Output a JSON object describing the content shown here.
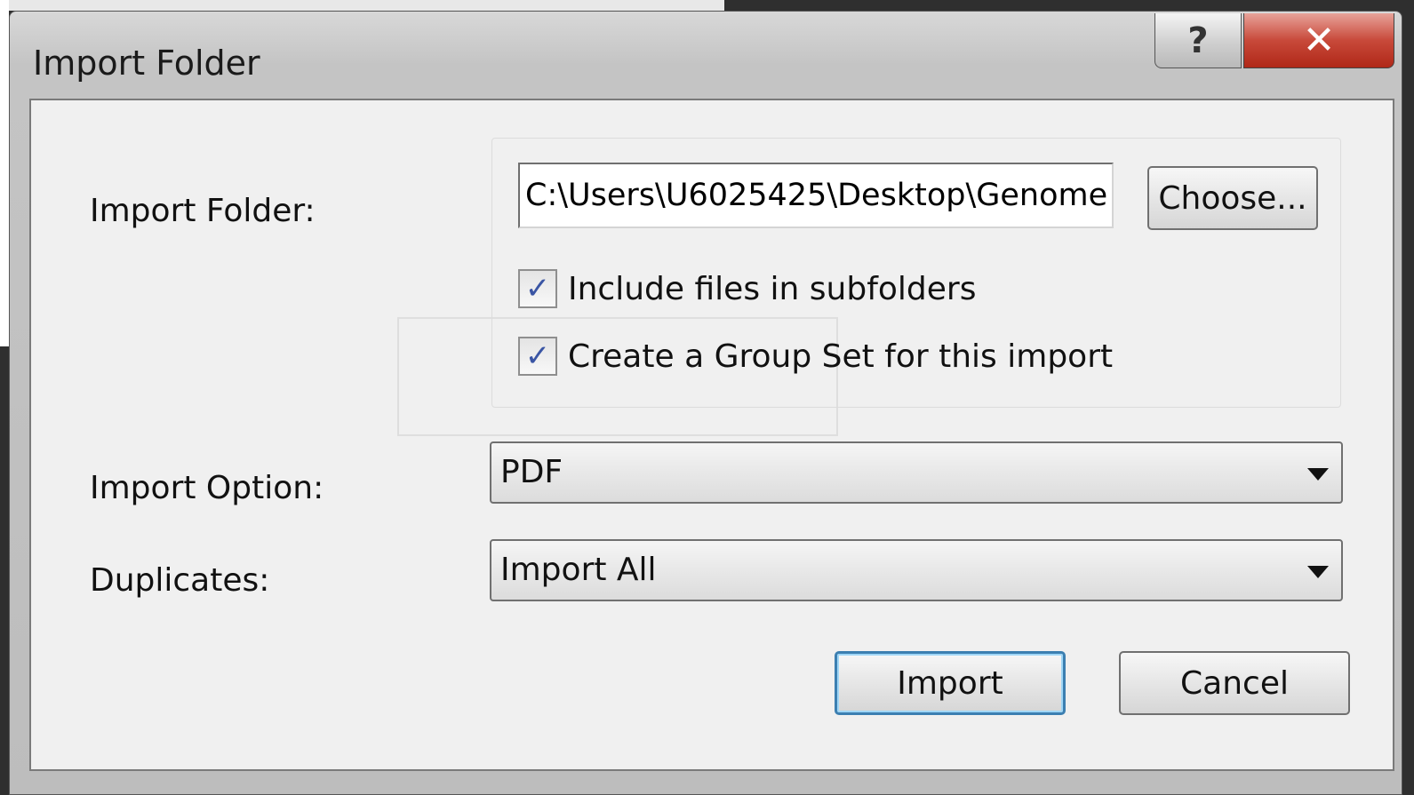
{
  "dialog": {
    "title": "Import Folder",
    "help_glyph": "?",
    "close_glyph": "✕"
  },
  "form": {
    "folder_label": "Import Folder:",
    "folder_path": "C:\\Users\\U6025425\\Desktop\\Genome",
    "choose_label": "Choose...",
    "include_subfolders_label": "Include files in subfolders",
    "include_subfolders_checked": true,
    "create_group_set_label": "Create a Group Set for this import",
    "create_group_set_checked": true,
    "import_option_label": "Import Option:",
    "import_option_value": "PDF",
    "duplicates_label": "Duplicates:",
    "duplicates_value": "Import All",
    "check_glyph": "✓"
  },
  "actions": {
    "import_label": "Import",
    "cancel_label": "Cancel"
  }
}
